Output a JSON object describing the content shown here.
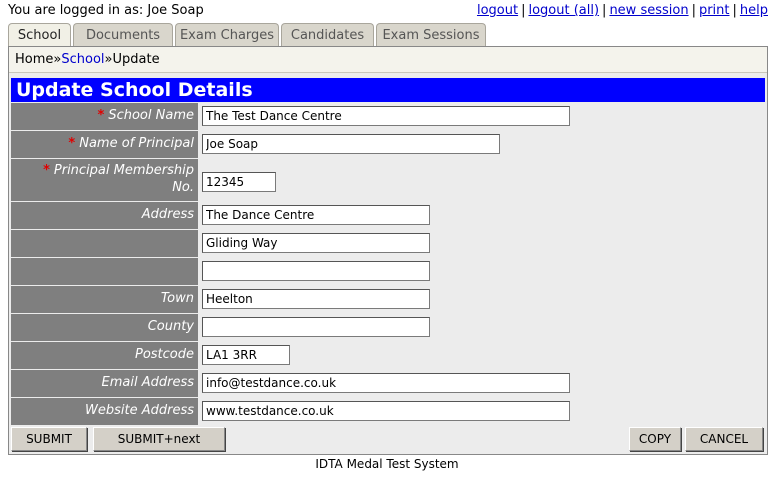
{
  "header": {
    "logged_in_text": "You are logged in as: Joe Soap",
    "links": [
      "logout",
      "logout (all)",
      "new session",
      "print",
      "help"
    ]
  },
  "tabs": [
    "School",
    "Documents",
    "Exam Charges",
    "Candidates",
    "Exam Sessions"
  ],
  "breadcrumb": {
    "home": "Home",
    "sep": "»",
    "school": "School",
    "current": "Update"
  },
  "title": "Update School Details",
  "fields": {
    "school_name": {
      "label": "School Name",
      "required": true,
      "value": "The Test Dance Centre"
    },
    "principal_name": {
      "label": "Name of Principal",
      "required": true,
      "value": "Joe Soap"
    },
    "membership_line1": "Principal Membership",
    "membership_line2": "No.",
    "membership_value": "12345",
    "address": {
      "label": "Address",
      "line1": "The Dance Centre",
      "line2": "Gliding Way",
      "line3": ""
    },
    "town": {
      "label": "Town",
      "value": "Heelton"
    },
    "county": {
      "label": "County",
      "value": ""
    },
    "postcode": {
      "label": "Postcode",
      "value": "LA1 3RR"
    },
    "email": {
      "label": "Email Address",
      "value": "info@testdance.co.uk"
    },
    "website": {
      "label": "Website Address",
      "value": "www.testdance.co.uk"
    }
  },
  "required_marker": "*",
  "buttons": {
    "submit": "SUBMIT",
    "submit_next": "SUBMIT+next",
    "copy": "COPY",
    "cancel": "CANCEL"
  },
  "footer": "IDTA Medal Test System",
  "colors": {
    "title_bar": "#0000ff",
    "label_bg": "#7f7f7f",
    "required": "#e00000",
    "link": "#0000cc"
  }
}
